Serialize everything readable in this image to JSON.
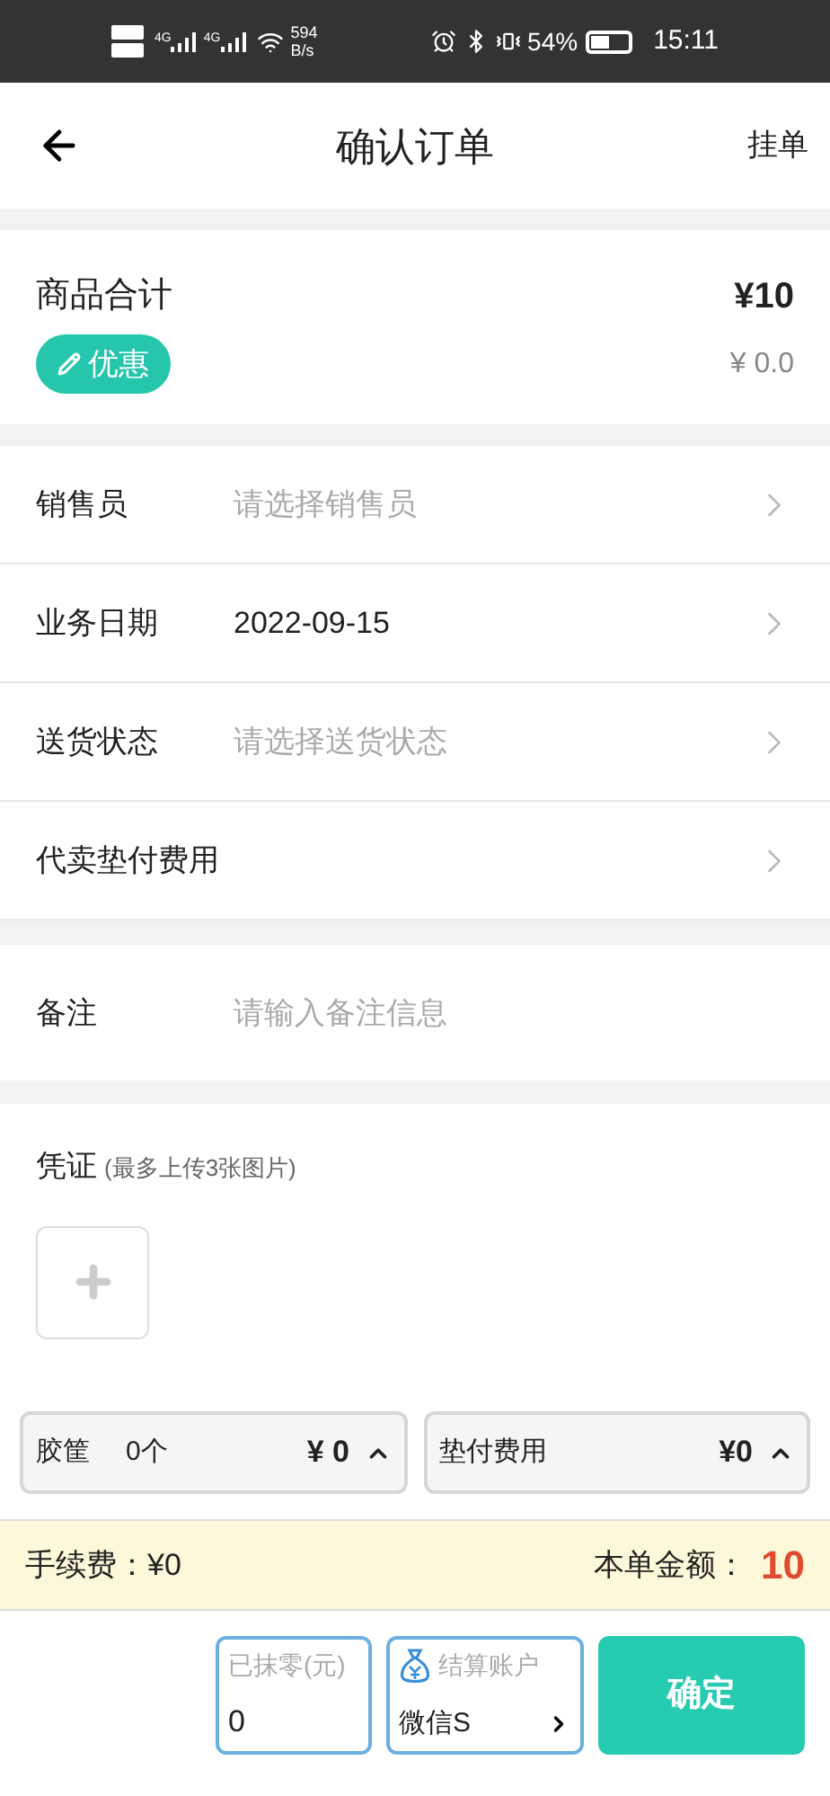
{
  "status_bar": {
    "network_labels": [
      "4G",
      "4G"
    ],
    "speed": "594",
    "speed_unit": "B/s",
    "battery": "54%",
    "time": "15:11"
  },
  "header": {
    "title": "确认订单",
    "action": "挂单"
  },
  "summary": {
    "label": "商品合计",
    "total": "¥10",
    "discount_button": "优惠",
    "discount": "¥ 0.0"
  },
  "rows": [
    {
      "label": "销售员",
      "placeholder": "请选择销售员"
    },
    {
      "label": "业务日期",
      "value": "2022-09-15"
    },
    {
      "label": "送货状态",
      "placeholder": "请选择送货状态"
    },
    {
      "label": "代卖垫付费用"
    }
  ],
  "remark": {
    "label": "备注",
    "placeholder": "请输入备注信息"
  },
  "voucher": {
    "label": "凭证",
    "hint": "(最多上传3张图片)"
  },
  "chips": [
    {
      "label": "胶筐",
      "count": "0个",
      "amount": "¥ 0"
    },
    {
      "label": "垫付费用",
      "amount": "¥0"
    }
  ],
  "fee_bar": {
    "fee": "手续费：¥0",
    "total_label": "本单金额：",
    "total": "10"
  },
  "footer": {
    "rounding_label": "已抹零(元)",
    "rounding_value": "0",
    "account_label": "结算账户",
    "account_value": "微信S",
    "confirm": "确定"
  }
}
